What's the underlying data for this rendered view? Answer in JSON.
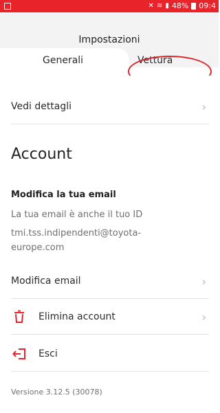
{
  "status_bar": {
    "battery": "48%",
    "time": "09:4"
  },
  "header": {
    "title": "Impostazioni",
    "tabs": [
      {
        "label": "Generali",
        "selected": true
      },
      {
        "label": "Vettura",
        "selected": false
      }
    ]
  },
  "settings": {
    "view_details": "Vedi dettagli",
    "account_title": "Account",
    "email_section_title": "Modifica la tua email",
    "email_hint": "La tua email è anche il tuo ID",
    "email_line1": "tmi.tss.indipendenti@toyota-",
    "email_line2": "europe.com",
    "modify_email": "Modifica email",
    "delete_account": "Elimina account",
    "logout": "Esci",
    "version": "Versione 3.12.5 (30078)"
  },
  "colors": {
    "accent": "#e8232a",
    "annotation": "#d6262b"
  },
  "icons": {
    "delete": "trash-icon",
    "logout": "logout-icon",
    "chevron": "chevron-right-icon"
  }
}
